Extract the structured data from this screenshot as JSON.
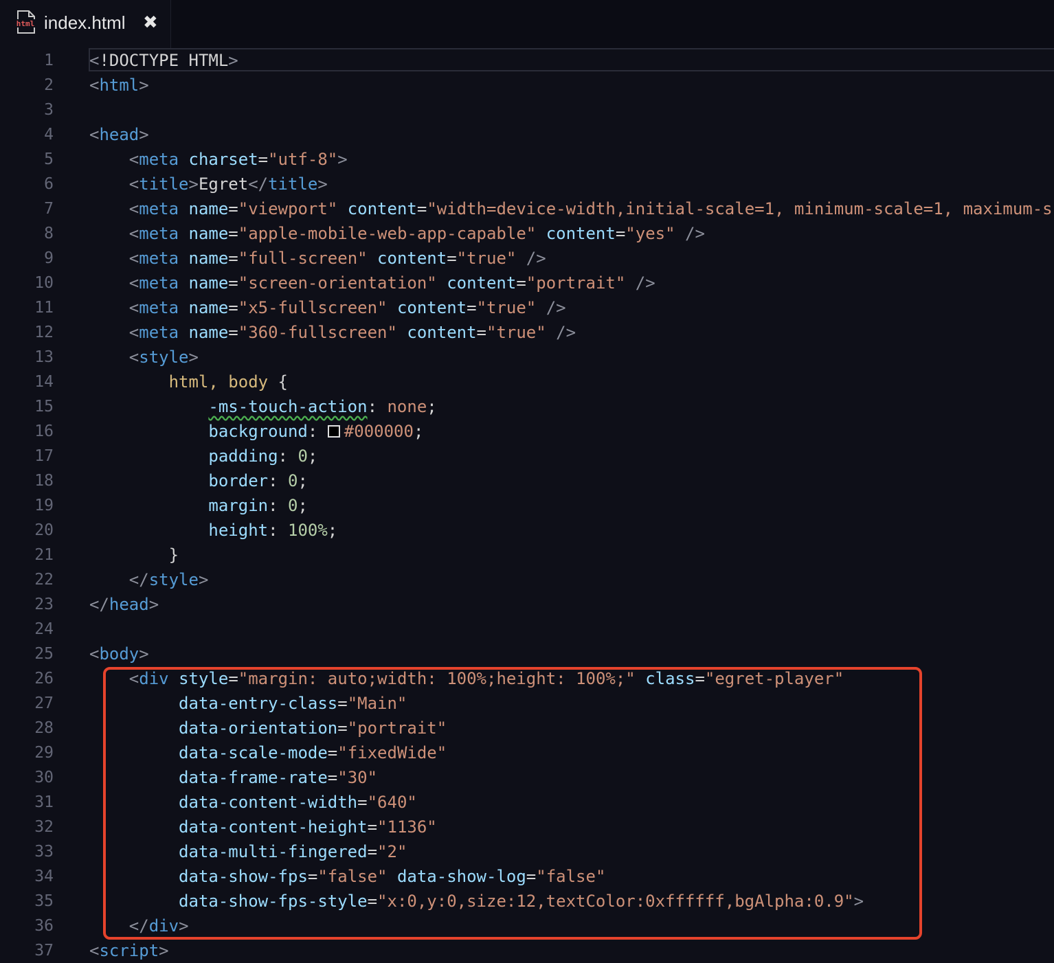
{
  "tab": {
    "title": "index.html",
    "close": "✖",
    "icon": "html-file-icon",
    "icon_text": "html"
  },
  "colors": {
    "background": "#0e0f18",
    "highlight": "#e5432c",
    "tag": "#569cd6",
    "attribute": "#9cdcfe",
    "string": "#ce9178"
  },
  "lines": [
    [
      {
        "t": "<",
        "c": "p"
      },
      {
        "t": "!DOCTYPE HTML",
        "c": "w"
      },
      {
        "t": ">",
        "c": "p"
      }
    ],
    [
      {
        "t": "<",
        "c": "p"
      },
      {
        "t": "html",
        "c": "tag"
      },
      {
        "t": ">",
        "c": "p"
      }
    ],
    [],
    [
      {
        "t": "<",
        "c": "p"
      },
      {
        "t": "head",
        "c": "tag"
      },
      {
        "t": ">",
        "c": "p"
      }
    ],
    [
      {
        "t": "    ",
        "c": "w"
      },
      {
        "t": "<",
        "c": "p"
      },
      {
        "t": "meta",
        "c": "tag"
      },
      {
        "t": " ",
        "c": "w"
      },
      {
        "t": "charset",
        "c": "attr"
      },
      {
        "t": "=",
        "c": "w"
      },
      {
        "t": "\"utf-8\"",
        "c": "str"
      },
      {
        "t": ">",
        "c": "p"
      }
    ],
    [
      {
        "t": "    ",
        "c": "w"
      },
      {
        "t": "<",
        "c": "p"
      },
      {
        "t": "title",
        "c": "tag"
      },
      {
        "t": ">",
        "c": "p"
      },
      {
        "t": "Egret",
        "c": "w"
      },
      {
        "t": "</",
        "c": "p"
      },
      {
        "t": "title",
        "c": "tag"
      },
      {
        "t": ">",
        "c": "p"
      }
    ],
    [
      {
        "t": "    ",
        "c": "w"
      },
      {
        "t": "<",
        "c": "p"
      },
      {
        "t": "meta",
        "c": "tag"
      },
      {
        "t": " ",
        "c": "w"
      },
      {
        "t": "name",
        "c": "attr"
      },
      {
        "t": "=",
        "c": "w"
      },
      {
        "t": "\"viewport\"",
        "c": "str"
      },
      {
        "t": " ",
        "c": "w"
      },
      {
        "t": "content",
        "c": "attr"
      },
      {
        "t": "=",
        "c": "w"
      },
      {
        "t": "\"width=device-width,initial-scale=1, minimum-scale=1, maximum-s",
        "c": "str"
      }
    ],
    [
      {
        "t": "    ",
        "c": "w"
      },
      {
        "t": "<",
        "c": "p"
      },
      {
        "t": "meta",
        "c": "tag"
      },
      {
        "t": " ",
        "c": "w"
      },
      {
        "t": "name",
        "c": "attr"
      },
      {
        "t": "=",
        "c": "w"
      },
      {
        "t": "\"apple-mobile-web-app-capable\"",
        "c": "str"
      },
      {
        "t": " ",
        "c": "w"
      },
      {
        "t": "content",
        "c": "attr"
      },
      {
        "t": "=",
        "c": "w"
      },
      {
        "t": "\"yes\"",
        "c": "str"
      },
      {
        "t": " />",
        "c": "p"
      }
    ],
    [
      {
        "t": "    ",
        "c": "w"
      },
      {
        "t": "<",
        "c": "p"
      },
      {
        "t": "meta",
        "c": "tag"
      },
      {
        "t": " ",
        "c": "w"
      },
      {
        "t": "name",
        "c": "attr"
      },
      {
        "t": "=",
        "c": "w"
      },
      {
        "t": "\"full-screen\"",
        "c": "str"
      },
      {
        "t": " ",
        "c": "w"
      },
      {
        "t": "content",
        "c": "attr"
      },
      {
        "t": "=",
        "c": "w"
      },
      {
        "t": "\"true\"",
        "c": "str"
      },
      {
        "t": " />",
        "c": "p"
      }
    ],
    [
      {
        "t": "    ",
        "c": "w"
      },
      {
        "t": "<",
        "c": "p"
      },
      {
        "t": "meta",
        "c": "tag"
      },
      {
        "t": " ",
        "c": "w"
      },
      {
        "t": "name",
        "c": "attr"
      },
      {
        "t": "=",
        "c": "w"
      },
      {
        "t": "\"screen-orientation\"",
        "c": "str"
      },
      {
        "t": " ",
        "c": "w"
      },
      {
        "t": "content",
        "c": "attr"
      },
      {
        "t": "=",
        "c": "w"
      },
      {
        "t": "\"portrait\"",
        "c": "str"
      },
      {
        "t": " />",
        "c": "p"
      }
    ],
    [
      {
        "t": "    ",
        "c": "w"
      },
      {
        "t": "<",
        "c": "p"
      },
      {
        "t": "meta",
        "c": "tag"
      },
      {
        "t": " ",
        "c": "w"
      },
      {
        "t": "name",
        "c": "attr"
      },
      {
        "t": "=",
        "c": "w"
      },
      {
        "t": "\"x5-fullscreen\"",
        "c": "str"
      },
      {
        "t": " ",
        "c": "w"
      },
      {
        "t": "content",
        "c": "attr"
      },
      {
        "t": "=",
        "c": "w"
      },
      {
        "t": "\"true\"",
        "c": "str"
      },
      {
        "t": " />",
        "c": "p"
      }
    ],
    [
      {
        "t": "    ",
        "c": "w"
      },
      {
        "t": "<",
        "c": "p"
      },
      {
        "t": "meta",
        "c": "tag"
      },
      {
        "t": " ",
        "c": "w"
      },
      {
        "t": "name",
        "c": "attr"
      },
      {
        "t": "=",
        "c": "w"
      },
      {
        "t": "\"360-fullscreen\"",
        "c": "str"
      },
      {
        "t": " ",
        "c": "w"
      },
      {
        "t": "content",
        "c": "attr"
      },
      {
        "t": "=",
        "c": "w"
      },
      {
        "t": "\"true\"",
        "c": "str"
      },
      {
        "t": " />",
        "c": "p"
      }
    ],
    [
      {
        "t": "    ",
        "c": "w"
      },
      {
        "t": "<",
        "c": "p"
      },
      {
        "t": "style",
        "c": "tag"
      },
      {
        "t": ">",
        "c": "p"
      }
    ],
    [
      {
        "t": "        ",
        "c": "w"
      },
      {
        "t": "html, body",
        "c": "sel"
      },
      {
        "t": " {",
        "c": "w"
      }
    ],
    [
      {
        "t": "            ",
        "c": "w"
      },
      {
        "t": "-ms-touch-action",
        "c": "prop",
        "sq": true
      },
      {
        "t": ": ",
        "c": "w"
      },
      {
        "t": "none",
        "c": "str"
      },
      {
        "t": ";",
        "c": "w"
      }
    ],
    [
      {
        "t": "            ",
        "c": "w"
      },
      {
        "t": "background",
        "c": "prop"
      },
      {
        "t": ": ",
        "c": "w"
      },
      {
        "t": "",
        "c": "swatch"
      },
      {
        "t": "#000000",
        "c": "str"
      },
      {
        "t": ";",
        "c": "w"
      }
    ],
    [
      {
        "t": "            ",
        "c": "w"
      },
      {
        "t": "padding",
        "c": "prop"
      },
      {
        "t": ": ",
        "c": "w"
      },
      {
        "t": "0",
        "c": "num"
      },
      {
        "t": ";",
        "c": "w"
      }
    ],
    [
      {
        "t": "            ",
        "c": "w"
      },
      {
        "t": "border",
        "c": "prop"
      },
      {
        "t": ": ",
        "c": "w"
      },
      {
        "t": "0",
        "c": "num"
      },
      {
        "t": ";",
        "c": "w"
      }
    ],
    [
      {
        "t": "            ",
        "c": "w"
      },
      {
        "t": "margin",
        "c": "prop"
      },
      {
        "t": ": ",
        "c": "w"
      },
      {
        "t": "0",
        "c": "num"
      },
      {
        "t": ";",
        "c": "w"
      }
    ],
    [
      {
        "t": "            ",
        "c": "w"
      },
      {
        "t": "height",
        "c": "prop"
      },
      {
        "t": ": ",
        "c": "w"
      },
      {
        "t": "100%",
        "c": "num"
      },
      {
        "t": ";",
        "c": "w"
      }
    ],
    [
      {
        "t": "        }",
        "c": "w"
      }
    ],
    [
      {
        "t": "    ",
        "c": "w"
      },
      {
        "t": "</",
        "c": "p"
      },
      {
        "t": "style",
        "c": "tag"
      },
      {
        "t": ">",
        "c": "p"
      }
    ],
    [
      {
        "t": "</",
        "c": "p"
      },
      {
        "t": "head",
        "c": "tag"
      },
      {
        "t": ">",
        "c": "p"
      }
    ],
    [],
    [
      {
        "t": "<",
        "c": "p"
      },
      {
        "t": "body",
        "c": "tag"
      },
      {
        "t": ">",
        "c": "p"
      }
    ],
    [
      {
        "t": "    ",
        "c": "w"
      },
      {
        "t": "<",
        "c": "p"
      },
      {
        "t": "div",
        "c": "tag"
      },
      {
        "t": " ",
        "c": "w"
      },
      {
        "t": "style",
        "c": "attr"
      },
      {
        "t": "=",
        "c": "w"
      },
      {
        "t": "\"margin: auto;width: 100%;height: 100%;\"",
        "c": "str"
      },
      {
        "t": " ",
        "c": "w"
      },
      {
        "t": "class",
        "c": "attr"
      },
      {
        "t": "=",
        "c": "w"
      },
      {
        "t": "\"egret-player\"",
        "c": "str"
      }
    ],
    [
      {
        "t": "         ",
        "c": "w"
      },
      {
        "t": "data-entry-class",
        "c": "attr"
      },
      {
        "t": "=",
        "c": "w"
      },
      {
        "t": "\"Main\"",
        "c": "str"
      }
    ],
    [
      {
        "t": "         ",
        "c": "w"
      },
      {
        "t": "data-orientation",
        "c": "attr"
      },
      {
        "t": "=",
        "c": "w"
      },
      {
        "t": "\"portrait\"",
        "c": "str"
      }
    ],
    [
      {
        "t": "         ",
        "c": "w"
      },
      {
        "t": "data-scale-mode",
        "c": "attr"
      },
      {
        "t": "=",
        "c": "w"
      },
      {
        "t": "\"fixedWide\"",
        "c": "str"
      }
    ],
    [
      {
        "t": "         ",
        "c": "w"
      },
      {
        "t": "data-frame-rate",
        "c": "attr"
      },
      {
        "t": "=",
        "c": "w"
      },
      {
        "t": "\"30\"",
        "c": "str"
      }
    ],
    [
      {
        "t": "         ",
        "c": "w"
      },
      {
        "t": "data-content-width",
        "c": "attr"
      },
      {
        "t": "=",
        "c": "w"
      },
      {
        "t": "\"640\"",
        "c": "str"
      }
    ],
    [
      {
        "t": "         ",
        "c": "w"
      },
      {
        "t": "data-content-height",
        "c": "attr"
      },
      {
        "t": "=",
        "c": "w"
      },
      {
        "t": "\"1136\"",
        "c": "str"
      }
    ],
    [
      {
        "t": "         ",
        "c": "w"
      },
      {
        "t": "data-multi-fingered",
        "c": "attr"
      },
      {
        "t": "=",
        "c": "w"
      },
      {
        "t": "\"2\"",
        "c": "str"
      }
    ],
    [
      {
        "t": "         ",
        "c": "w"
      },
      {
        "t": "data-show-fps",
        "c": "attr"
      },
      {
        "t": "=",
        "c": "w"
      },
      {
        "t": "\"false\"",
        "c": "str"
      },
      {
        "t": " ",
        "c": "w"
      },
      {
        "t": "data-show-log",
        "c": "attr"
      },
      {
        "t": "=",
        "c": "w"
      },
      {
        "t": "\"false\"",
        "c": "str"
      }
    ],
    [
      {
        "t": "         ",
        "c": "w"
      },
      {
        "t": "data-show-fps-style",
        "c": "attr"
      },
      {
        "t": "=",
        "c": "w"
      },
      {
        "t": "\"x:0,y:0,size:12,textColor:0xffffff,bgAlpha:0.9\"",
        "c": "str"
      },
      {
        "t": ">",
        "c": "p"
      }
    ],
    [
      {
        "t": "    ",
        "c": "w"
      },
      {
        "t": "</",
        "c": "p"
      },
      {
        "t": "div",
        "c": "tag"
      },
      {
        "t": ">",
        "c": "p"
      }
    ],
    [
      {
        "t": "<",
        "c": "p"
      },
      {
        "t": "script",
        "c": "tag"
      },
      {
        "t": ">",
        "c": "p"
      }
    ]
  ]
}
